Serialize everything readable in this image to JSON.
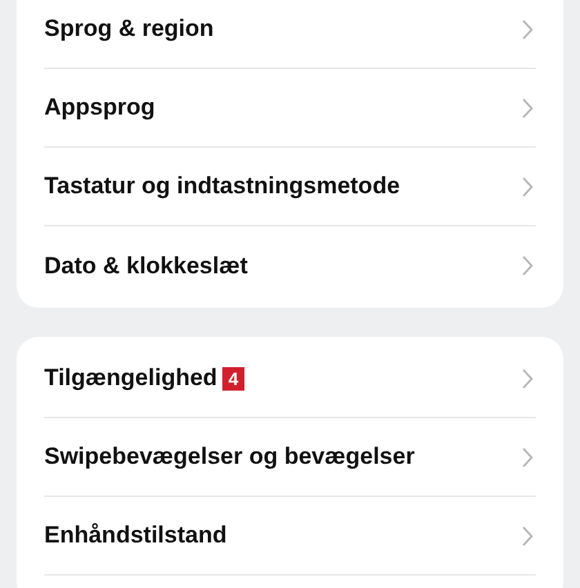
{
  "groups": [
    {
      "items": [
        {
          "label": "Sprog & region"
        },
        {
          "label": "Appsprog"
        },
        {
          "label": "Tastatur og indtastningsmetode"
        },
        {
          "label": "Dato & klokkeslæt"
        }
      ]
    },
    {
      "items": [
        {
          "label": "Tilgængelighed",
          "badge": "4"
        },
        {
          "label": "Swipebevægelser og bevægelser"
        },
        {
          "label": "Enhåndstilstand"
        }
      ]
    }
  ]
}
